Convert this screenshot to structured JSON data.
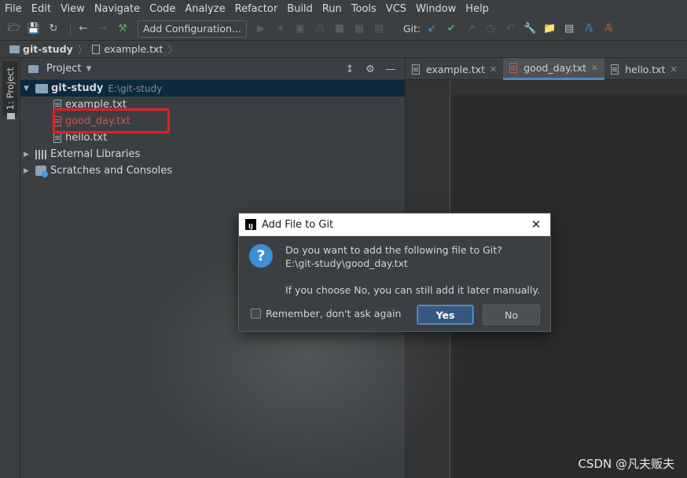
{
  "menu": [
    "File",
    "Edit",
    "View",
    "Navigate",
    "Code",
    "Analyze",
    "Refactor",
    "Build",
    "Run",
    "Tools",
    "VCS",
    "Window",
    "Help"
  ],
  "toolbar": {
    "add_configuration": "Add Configuration...",
    "git_label": "Git:"
  },
  "breadcrumb": {
    "project": "git-study",
    "file": "example.txt"
  },
  "left_strip": {
    "project_tab": "1: Project"
  },
  "project_panel": {
    "title": "Project",
    "tree": {
      "root_name": "git-study",
      "root_path": "E:\\git-study",
      "files": [
        "example.txt",
        "good_day.txt",
        "hello.txt"
      ],
      "external_libraries": "External Libraries",
      "scratches": "Scratches and Consoles"
    }
  },
  "editor": {
    "tabs": [
      "example.txt",
      "good_day.txt",
      "hello.txt"
    ],
    "active_tab": "good_day.txt"
  },
  "dialog": {
    "title": "Add File to Git",
    "question": "Do you want to add the following file to Git?",
    "path": "E:\\git-study\\good_day.txt",
    "note": "If you choose No, you can still add it later manually.",
    "remember_label": "Remember, don't ask again",
    "yes_label": "Yes",
    "no_label": "No"
  },
  "watermark": "CSDN @凡夫贩夫",
  "colors": {
    "accent_blue": "#3d8fd6",
    "unversioned_red": "#d25252",
    "highlight_box": "#e02020"
  }
}
